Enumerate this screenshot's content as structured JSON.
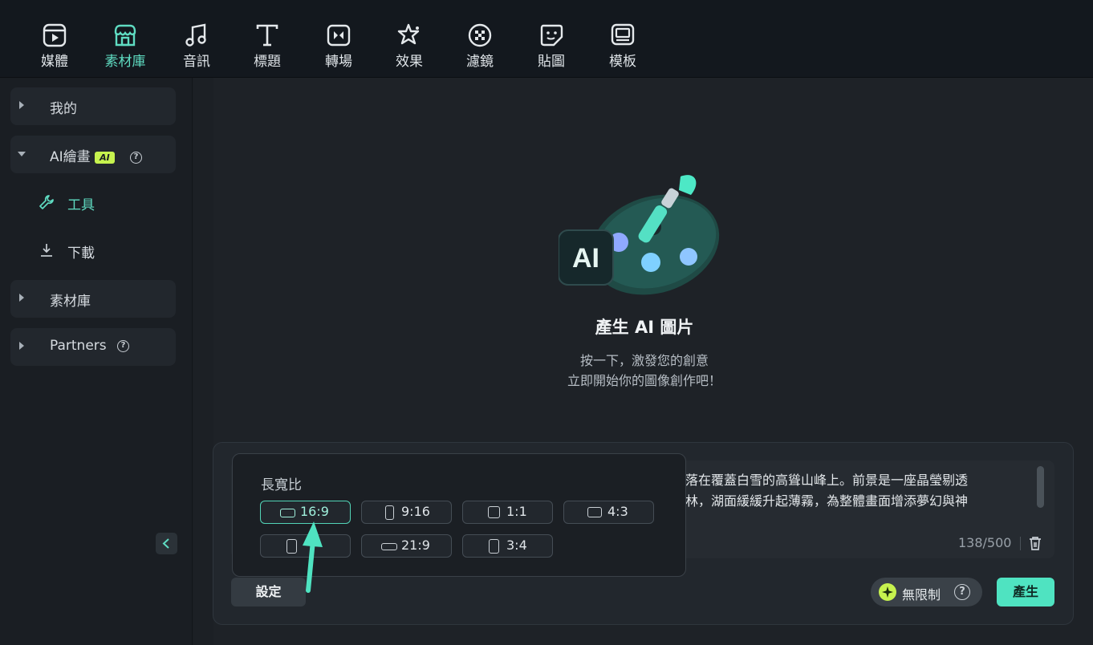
{
  "tabs": [
    {
      "label": "媒體",
      "icon": "media-icon"
    },
    {
      "label": "素材庫",
      "icon": "store-icon",
      "active": true
    },
    {
      "label": "音訊",
      "icon": "music-note-icon"
    },
    {
      "label": "標題",
      "icon": "text-t-icon"
    },
    {
      "label": "轉場",
      "icon": "transition-icon"
    },
    {
      "label": "效果",
      "icon": "effects-star-icon"
    },
    {
      "label": "濾鏡",
      "icon": "filter-icon"
    },
    {
      "label": "貼圖",
      "icon": "sticker-icon"
    },
    {
      "label": "模板",
      "icon": "template-icon"
    }
  ],
  "sidebar": {
    "my": "我的",
    "ai_drawing": "AI繪畫",
    "ai_badge": "AI",
    "tools": "工具",
    "downloads": "下載",
    "library": "素材庫",
    "partners": "Partners"
  },
  "hero": {
    "title": "產生 AI 圖片",
    "line1": "按一下，激發您的創意",
    "line2": "立即開始你的圖像創作吧！"
  },
  "prompt": {
    "line1": "光灑落在覆蓋白雪的高聳山峰上。前景是一座晶瑩剔透",
    "line2": "松樹林，湖面緩緩升起薄霧，為整體畫面增添夢幻與神",
    "counter": "138/500"
  },
  "aspect": {
    "title": "長寬比",
    "options": [
      {
        "label": "16:9",
        "selected": true
      },
      {
        "label": "9:16"
      },
      {
        "label": "1:1"
      },
      {
        "label": "4:3"
      },
      {
        "label": "3:4 ",
        "hidden_label": true
      },
      {
        "label": "21:9"
      },
      {
        "label": "3:4"
      }
    ]
  },
  "buttons": {
    "settings": "設定",
    "unlimited": "無限制",
    "generate": "產生"
  },
  "colors": {
    "accent": "#4fe3c1",
    "active_tab": "#5fdcc2",
    "ai_badge": "#c6f24e"
  }
}
